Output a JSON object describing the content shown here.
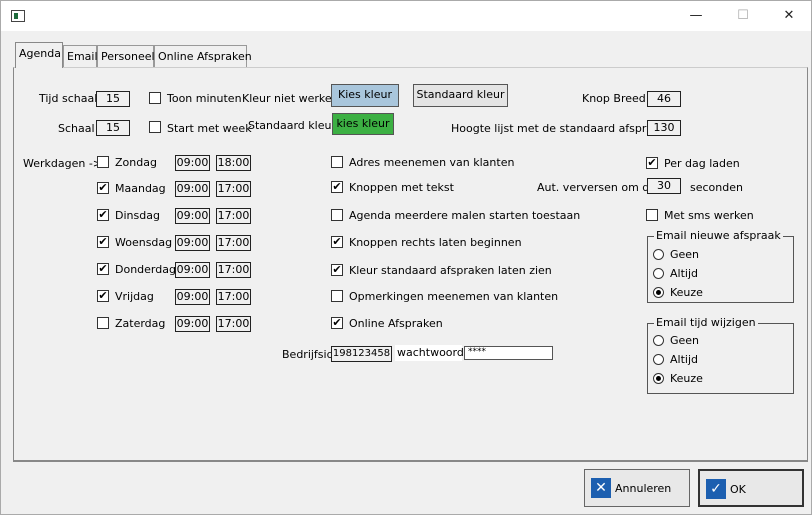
{
  "window": {
    "app_icon": "app-window-icon",
    "controls": {
      "minimize": "—",
      "maximize": "☐",
      "close": "✕"
    }
  },
  "tabs": [
    "Agenda",
    "Email",
    "Personeel",
    "Online Afspraken"
  ],
  "settings": {
    "tijd_schaal_label": "Tijd schaal",
    "tijd_schaal_value": "15",
    "schaal_label": "Schaal",
    "schaal_value": "15",
    "toon_minuten": "Toon minuten",
    "start_met_week": "Start met week",
    "kleur_niet_werken": "Kleur niet werken",
    "kies_kleur_1": "Kies kleur",
    "standaard_kleur_btn": "Standaard kleur",
    "standaard_kleur_label": "Standaard kleur",
    "kies_kleur_2": "kies kleur",
    "knop_breed_label": "Knop Breed",
    "knop_breed_value": "46",
    "hoogte_label": "Hoogte lijst met de standaard afspraken",
    "hoogte_value": "130"
  },
  "workdays": {
    "label": "Werkdagen ->",
    "days": [
      {
        "name": "Zondag",
        "checked": false,
        "start": "09:00",
        "end": "18:00"
      },
      {
        "name": "Maandag",
        "checked": true,
        "start": "09:00",
        "end": "17:00"
      },
      {
        "name": "Dinsdag",
        "checked": true,
        "start": "09:00",
        "end": "17:00"
      },
      {
        "name": "Woensdag",
        "checked": true,
        "start": "09:00",
        "end": "17:00"
      },
      {
        "name": "Donderdag",
        "checked": true,
        "start": "09:00",
        "end": "17:00"
      },
      {
        "name": "Vrijdag",
        "checked": true,
        "start": "09:00",
        "end": "17:00"
      },
      {
        "name": "Zaterdag",
        "checked": false,
        "start": "09:00",
        "end": "17:00"
      }
    ]
  },
  "options": [
    {
      "label": "Adres meenemen van klanten",
      "checked": false
    },
    {
      "label": "Knoppen met tekst",
      "checked": true
    },
    {
      "label": "Agenda meerdere malen starten toestaan",
      "checked": false
    },
    {
      "label": "Knoppen rechts laten beginnen",
      "checked": true
    },
    {
      "label": "Kleur standaard afspraken laten zien",
      "checked": true
    },
    {
      "label": "Opmerkingen meenemen van klanten",
      "checked": false
    },
    {
      "label": "Online Afspraken",
      "checked": true
    }
  ],
  "company": {
    "bedrijfsid_label": "Bedrijfsid",
    "bedrijfsid_value": "198123458",
    "wachtwoord_label": "wachtwoord",
    "wachtwoord_value": "****"
  },
  "right": {
    "per_dag_laden": "Per dag laden",
    "per_dag_laden_checked": true,
    "aut_verversen": "Aut. verversen om de",
    "aut_verversen_value": "30",
    "seconden": "seconden",
    "met_sms_werken": "Met sms werken",
    "met_sms_checked": false
  },
  "email_nieuwe": {
    "title": "Email nieuwe afspraak",
    "options": [
      "Geen",
      "Altijd",
      "Keuze"
    ],
    "selected": 2
  },
  "email_tijd": {
    "title": "Email tijd wijzigen",
    "options": [
      "Geen",
      "Altijd",
      "Keuze"
    ],
    "selected": 2
  },
  "footer": {
    "annuleren": "Annuleren",
    "ok": "OK"
  },
  "colors": {
    "kies_kleur_1": "#a9c6dc",
    "kies_kleur_2": "#3cb043",
    "accent": "#1c5fb0"
  }
}
